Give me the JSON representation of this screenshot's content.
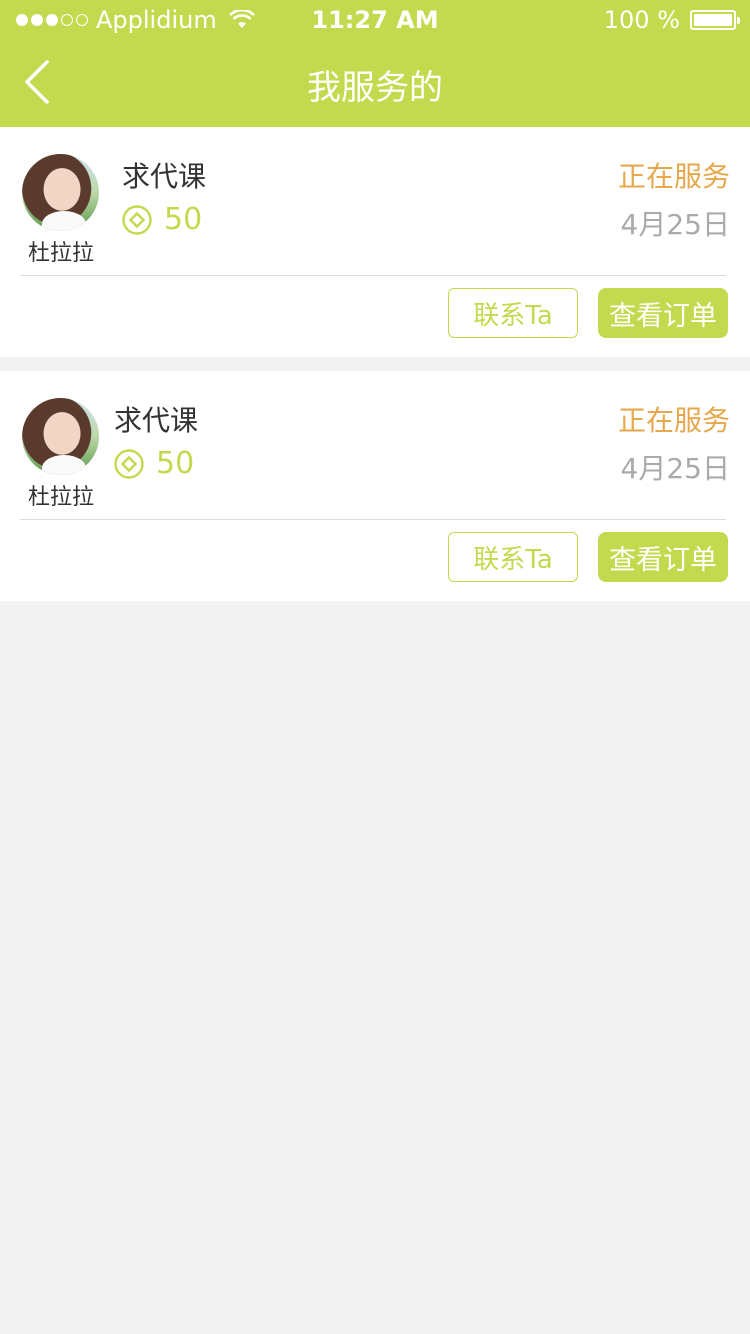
{
  "status_bar": {
    "carrier": "Applidium",
    "time": "11:27 AM",
    "battery": "100 %"
  },
  "header": {
    "title": "我服务的",
    "back_icon": "chevron-left-icon"
  },
  "colors": {
    "accent": "#c3da4e",
    "status": "#e6a84a",
    "muted": "#aaaaaa"
  },
  "orders": [
    {
      "user": "杜拉拉",
      "title": "求代课",
      "coins": "50",
      "status": "正在服务",
      "date": "4月25日",
      "contact_label": "联系Ta",
      "view_label": "查看订单"
    },
    {
      "user": "杜拉拉",
      "title": "求代课",
      "coins": "50",
      "status": "正在服务",
      "date": "4月25日",
      "contact_label": "联系Ta",
      "view_label": "查看订单"
    }
  ]
}
